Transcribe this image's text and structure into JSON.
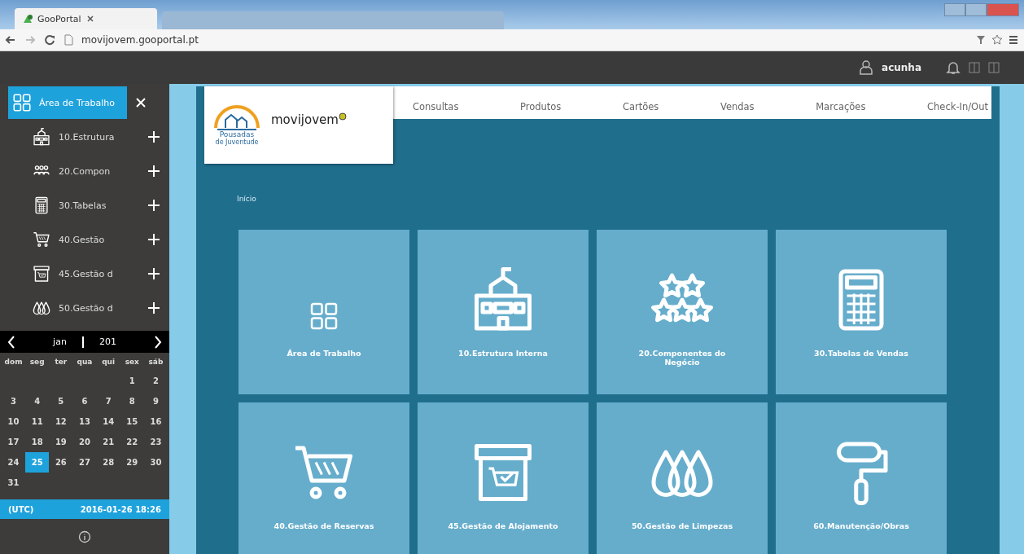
{
  "browser": {
    "tab_title": "GooPortal",
    "url": "movijovem.gooportal.pt"
  },
  "app_header": {
    "user": "acunha"
  },
  "sidebar": {
    "items": [
      {
        "label": "Área de Trabalho",
        "kind": "grid",
        "selected": true
      },
      {
        "label": "10.Estrutura",
        "kind": "school",
        "selected": false
      },
      {
        "label": "20.Compon",
        "kind": "people",
        "selected": false
      },
      {
        "label": "30.Tabelas",
        "kind": "calculator",
        "selected": false
      },
      {
        "label": "40.Gestão",
        "kind": "cart",
        "selected": false
      },
      {
        "label": "45.Gestão d",
        "kind": "box",
        "selected": false
      },
      {
        "label": "50.Gestão d",
        "kind": "drops",
        "selected": false
      }
    ]
  },
  "calendar": {
    "month": "jan",
    "year": "201",
    "weekdays": [
      "dom",
      "seg",
      "ter",
      "qua",
      "qui",
      "sex",
      "sáb"
    ],
    "weeks": [
      [
        {
          "day": "1",
          "selected": false
        },
        {
          "day": "2",
          "selected": false
        }
      ],
      [
        {
          "day": "3",
          "selected": false
        },
        {
          "day": "4",
          "selected": false
        },
        {
          "day": "5",
          "selected": false
        },
        {
          "day": "6",
          "selected": false
        },
        {
          "day": "7",
          "selected": false
        },
        {
          "day": "8",
          "selected": false
        },
        {
          "day": "9",
          "selected": false
        }
      ],
      [
        {
          "day": "10",
          "selected": false
        },
        {
          "day": "11",
          "selected": false
        },
        {
          "day": "12",
          "selected": false
        },
        {
          "day": "13",
          "selected": false
        },
        {
          "day": "14",
          "selected": false
        },
        {
          "day": "15",
          "selected": false
        },
        {
          "day": "16",
          "selected": false
        }
      ],
      [
        {
          "day": "17",
          "selected": false
        },
        {
          "day": "18",
          "selected": false
        },
        {
          "day": "19",
          "selected": false
        },
        {
          "day": "20",
          "selected": false
        },
        {
          "day": "21",
          "selected": false
        },
        {
          "day": "22",
          "selected": false
        },
        {
          "day": "23",
          "selected": false
        }
      ],
      [
        {
          "day": "24",
          "selected": false
        },
        {
          "day": "25",
          "selected": true
        },
        {
          "day": "26",
          "selected": false
        },
        {
          "day": "27",
          "selected": false
        },
        {
          "day": "28",
          "selected": false
        },
        {
          "day": "29",
          "selected": false
        },
        {
          "day": "30",
          "selected": false
        }
      ],
      [
        {
          "day": "31",
          "selected": false
        }
      ]
    ],
    "timezone": "(UTC)",
    "datetime": "2016-01-26 18:26"
  },
  "logo": {
    "name": "movijovem",
    "subtitle_1": "Pousadas",
    "subtitle_2": "de Juventude"
  },
  "nav": [
    "Consultas",
    "Produtos",
    "Cartões",
    "Vendas",
    "Marcações",
    "Check-In/Out"
  ],
  "breadcrumb": "Início",
  "tiles": [
    {
      "label": "Área de Trabalho",
      "kind": "grid"
    },
    {
      "label": "10.Estrutura Interna",
      "kind": "school"
    },
    {
      "label": "20.Componentes do Negócio",
      "kind": "stars"
    },
    {
      "label": "30.Tabelas de Vendas",
      "kind": "calculator"
    },
    {
      "label": "40.Gestão de Reservas",
      "kind": "cart"
    },
    {
      "label": "45.Gestão de Alojamento",
      "kind": "box"
    },
    {
      "label": "50.Gestão de Limpezas",
      "kind": "drops"
    },
    {
      "label": "60.Manutenção/Obras",
      "kind": "roller"
    }
  ]
}
